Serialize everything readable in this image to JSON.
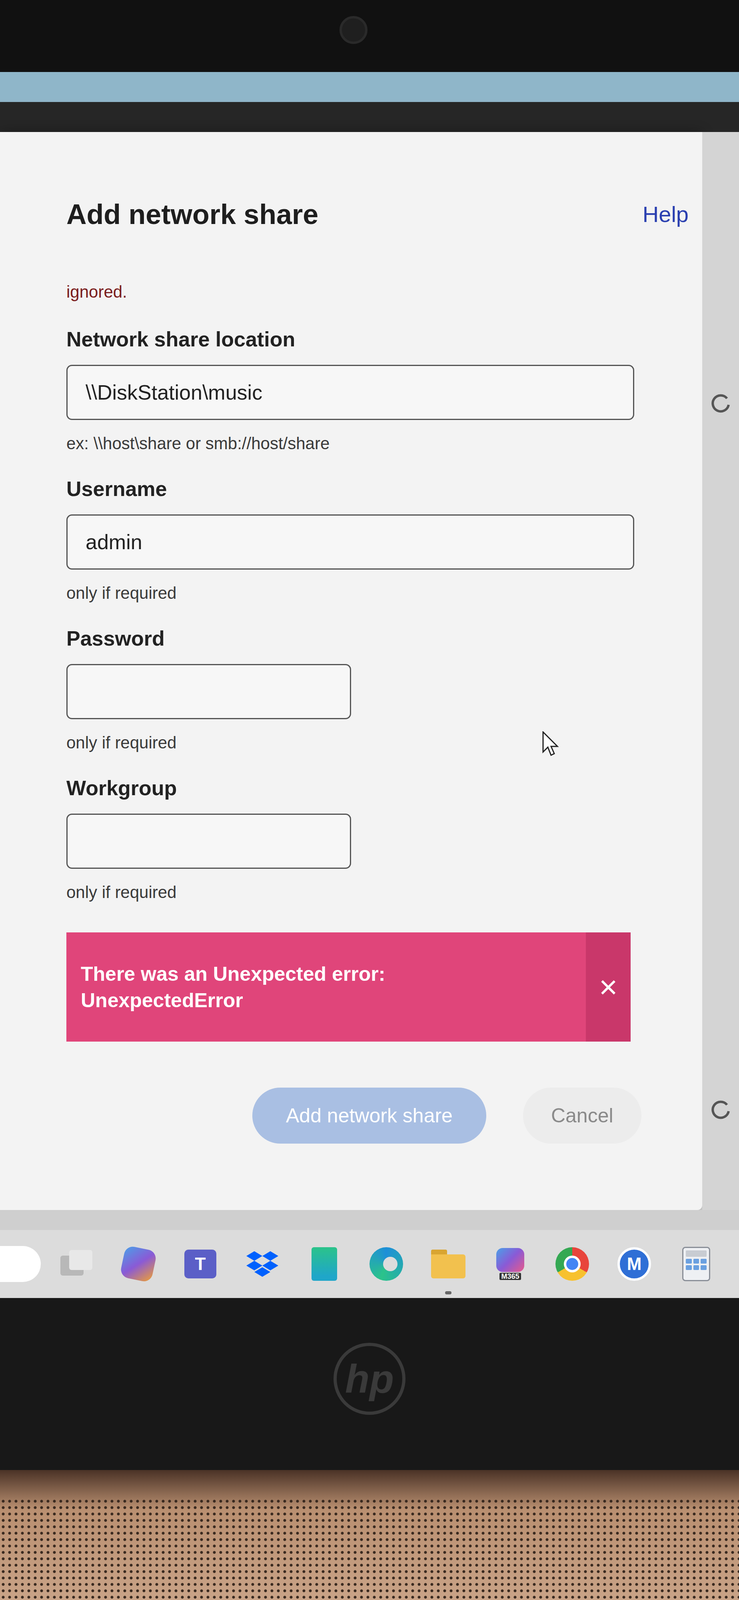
{
  "dialog": {
    "title": "Add network share",
    "help": "Help",
    "note": "ignored.",
    "fields": [
      {
        "label": "Network share location",
        "value": "\\\\DiskStation\\music",
        "hint": "ex: \\\\host\\share or smb://host/share",
        "kind": "wide"
      },
      {
        "label": "Username",
        "value": "admin",
        "hint": "only if required",
        "kind": "wide"
      },
      {
        "label": "Password",
        "value": "",
        "hint": "only if required",
        "kind": "short"
      },
      {
        "label": "Workgroup",
        "value": "",
        "hint": "only if required",
        "kind": "short"
      }
    ],
    "error": {
      "message": "There was an Unexpected error:",
      "code": "UnexpectedError",
      "close": "×"
    },
    "buttons": [
      {
        "label": "Add network share",
        "primary": true,
        "disabled": true
      },
      {
        "label": "Cancel",
        "primary": false,
        "disabled": false
      }
    ]
  },
  "taskbar": {
    "icons": [
      {
        "kind": "taskview",
        "label": "",
        "color": "#e8e8e8"
      },
      {
        "kind": "copilot",
        "label": "",
        "color": "#4aa0e8"
      },
      {
        "kind": "teams",
        "label": "T",
        "color": "#5b5fc7"
      },
      {
        "kind": "dropbox",
        "label": "",
        "color": "#0061fe"
      },
      {
        "kind": "app",
        "label": "",
        "color": "#1fa6c9"
      },
      {
        "kind": "edge",
        "label": "",
        "color": "#1e8fd8"
      },
      {
        "kind": "folder",
        "label": "",
        "color": "#f2c14e"
      },
      {
        "kind": "m365",
        "label": "M365",
        "color": "#5a8be0"
      },
      {
        "kind": "chrome",
        "label": "",
        "color": "#e8453c"
      },
      {
        "kind": "mcircle",
        "label": "M",
        "color": "#2f6fd6"
      },
      {
        "kind": "calculator",
        "label": "",
        "color": "#8a8f98"
      }
    ]
  },
  "laptop": {
    "logo": "hp"
  }
}
